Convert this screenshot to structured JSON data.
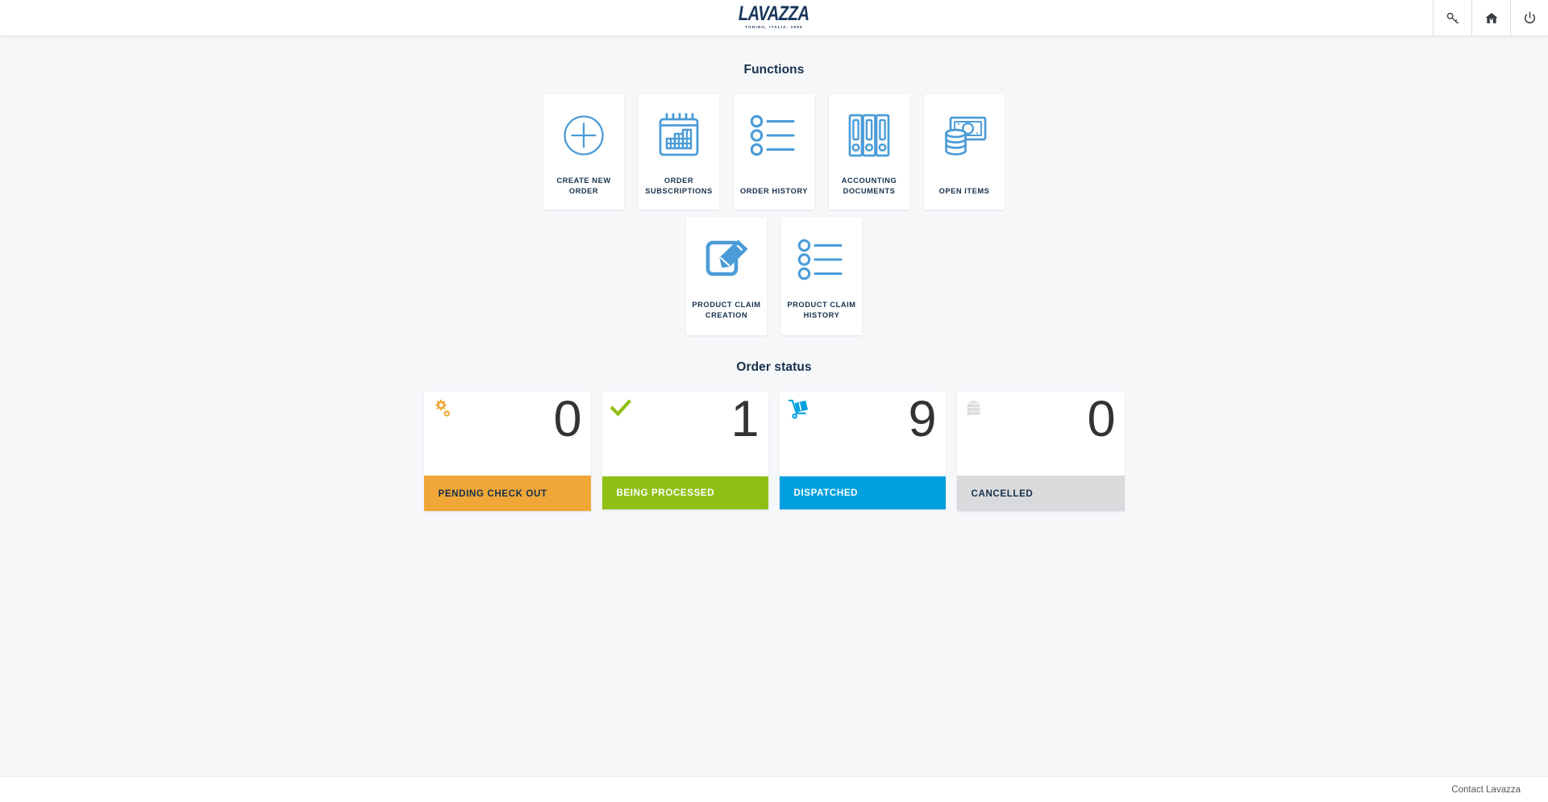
{
  "brand": {
    "logo_word": "LAVAZZA",
    "logo_tagline": "TORINO, ITALIA. 1895",
    "accent_blue": "#4b9cd8",
    "navy": "#16314d"
  },
  "header": {
    "actions": [
      {
        "name": "change-password",
        "icon": "key-icon",
        "label": "Change password"
      },
      {
        "name": "home",
        "icon": "home-icon",
        "label": "Home"
      },
      {
        "name": "logout",
        "icon": "power-icon",
        "label": "Logout"
      }
    ]
  },
  "functions": {
    "title": "Functions",
    "row1": [
      {
        "label": "CREATE NEW ORDER",
        "icon": "plus-circle-icon"
      },
      {
        "label": "ORDER SUBSCRIPTIONS",
        "icon": "calendar-grid-icon"
      },
      {
        "label": "ORDER HISTORY",
        "icon": "bullet-list-icon"
      },
      {
        "label": "ACCOUNTING DOCUMENTS",
        "icon": "binders-icon"
      },
      {
        "label": "OPEN ITEMS",
        "icon": "banknote-coins-icon"
      }
    ],
    "row2": [
      {
        "label": "PRODUCT CLAIM CREATION",
        "icon": "pencil-square-icon"
      },
      {
        "label": "PRODUCT CLAIM HISTORY",
        "icon": "bullet-list-icon"
      }
    ]
  },
  "order_status": {
    "title": "Order status",
    "cards": [
      {
        "label": "PENDING CHECK OUT",
        "count": "0",
        "icon": "gears-icon",
        "color": "#f0a737",
        "text_color": "#16314d"
      },
      {
        "label": "BEING PROCESSED",
        "count": "1",
        "icon": "check-icon",
        "color": "#8ec014",
        "text_color": "#ffffff"
      },
      {
        "label": "DISPATCHED",
        "count": "9",
        "icon": "hand-truck-icon",
        "color": "#00a0df",
        "text_color": "#ffffff"
      },
      {
        "label": "CANCELLED",
        "count": "0",
        "icon": "stacked-boxes-icon",
        "color": "#d9dadb",
        "text_color": "#16314d"
      }
    ]
  },
  "footer": {
    "contact_label": "Contact Lavazza"
  }
}
